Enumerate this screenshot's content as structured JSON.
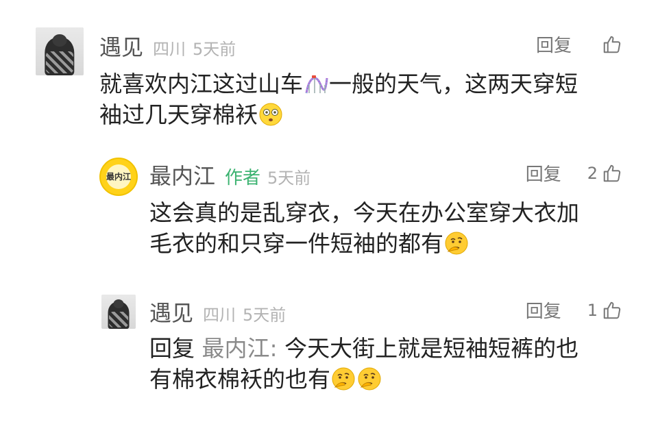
{
  "comments": [
    {
      "name": "遇见",
      "location": "四川",
      "time": "5天前",
      "reply_label": "回复",
      "likes": "",
      "text_parts": [
        "就喜欢内江这过山车",
        "一般的天气，这两天穿短",
        "袖过几天穿棉袄"
      ],
      "emojis": [
        "roller-coaster-emoji",
        "dizzy-face-emoji"
      ]
    },
    {
      "name": "最内江",
      "tag": "作者",
      "time": "5天前",
      "reply_label": "回复",
      "likes": "2",
      "avatar_text": "最内江",
      "text_lines": [
        "这会真的是乱穿衣，今天在办公室穿大衣加",
        "毛衣的和只穿一件短袖的都有"
      ],
      "emojis": [
        "thinking-face-emoji"
      ]
    },
    {
      "name": "遇见",
      "location": "四川",
      "time": "5天前",
      "reply_label": "回复",
      "likes": "1",
      "reply_prefix": "回复",
      "mention": "最内江:",
      "text_lines": [
        "今天大街上就是短袖短裤的也",
        "有棉衣棉袄的也有"
      ],
      "emojis": [
        "thinking-face-emoji",
        "thinking-face-emoji"
      ]
    }
  ],
  "colors": {
    "name": "#555555",
    "meta": "#b3b3b3",
    "author_tag": "#3cb371",
    "action": "#777777",
    "text": "#222222"
  }
}
